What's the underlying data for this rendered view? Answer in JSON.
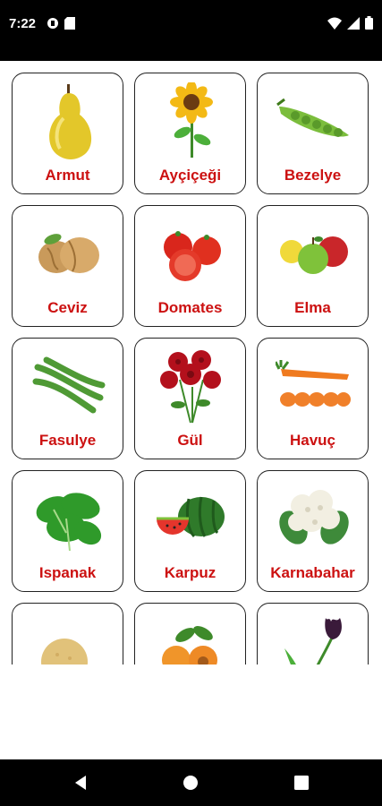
{
  "status": {
    "time": "7:22"
  },
  "items": [
    {
      "name": "Armut"
    },
    {
      "name": "Ayçiçeği"
    },
    {
      "name": "Bezelye"
    },
    {
      "name": "Ceviz"
    },
    {
      "name": "Domates"
    },
    {
      "name": "Elma"
    },
    {
      "name": "Fasulye"
    },
    {
      "name": "Gül"
    },
    {
      "name": "Havuç"
    },
    {
      "name": "Ispanak"
    },
    {
      "name": "Karpuz"
    },
    {
      "name": "Karnabahar"
    },
    {
      "name": ""
    },
    {
      "name": ""
    },
    {
      "name": ""
    }
  ],
  "colors": {
    "label": "#cc1111",
    "border": "#222222",
    "bars": "#000000"
  }
}
